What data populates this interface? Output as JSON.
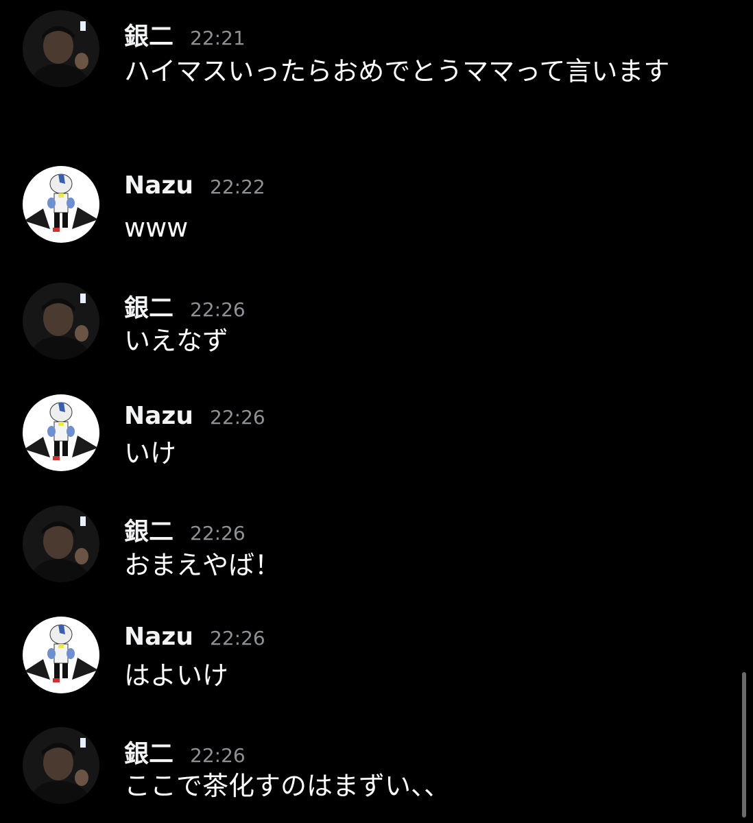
{
  "colors": {
    "background": "#000000",
    "author": "#f2f3f5",
    "timestamp": "#8e9297",
    "message_text": "#ffffff",
    "scrollbar": "#6b6b6b"
  },
  "messages": [
    {
      "author": "銀二",
      "time": "22:21",
      "text": "ハイマスいったらおめでとうママって言います",
      "avatar_icon": "ginji-avatar-icon"
    },
    {
      "author": "Nazu",
      "time": "22:22",
      "text": "www",
      "avatar_icon": "nazu-avatar-icon"
    },
    {
      "author": "銀二",
      "time": "22:26",
      "text": "いえなず",
      "avatar_icon": "ginji-avatar-icon"
    },
    {
      "author": "Nazu",
      "time": "22:26",
      "text": "いけ",
      "avatar_icon": "nazu-avatar-icon"
    },
    {
      "author": "銀二",
      "time": "22:26",
      "text": "おまえやば！",
      "avatar_icon": "ginji-avatar-icon"
    },
    {
      "author": "Nazu",
      "time": "22:26",
      "text": "はよいけ",
      "avatar_icon": "nazu-avatar-icon"
    },
    {
      "author": "銀二",
      "time": "22:26",
      "text": "ここで茶化すのはまずい、、",
      "avatar_icon": "ginji-avatar-icon"
    }
  ]
}
